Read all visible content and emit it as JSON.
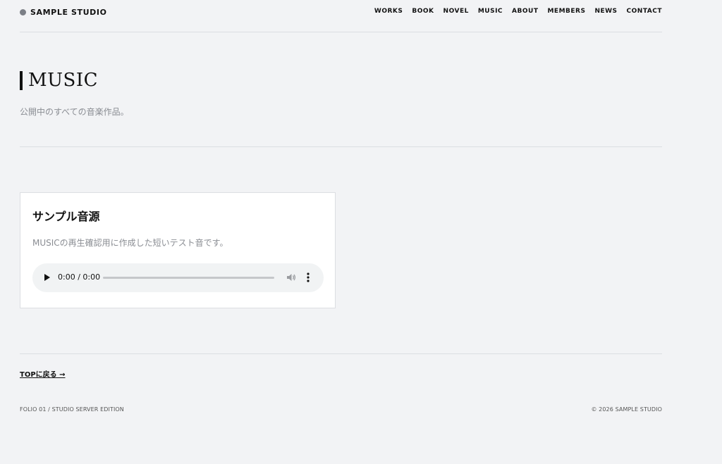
{
  "header": {
    "brand": "SAMPLE STUDIO",
    "nav": [
      "WORKS",
      "BOOK",
      "NOVEL",
      "MUSIC",
      "ABOUT",
      "MEMBERS",
      "NEWS",
      "CONTACT"
    ]
  },
  "page": {
    "title": "MUSIC",
    "description": "公開中のすべての音楽作品。"
  },
  "track": {
    "title": "サンプル音源",
    "description": "MUSICの再生確認用に作成した短いテスト音です。",
    "player": {
      "time": "0:00 / 0:00",
      "progress": 0,
      "icons": [
        "play-icon",
        "volume-icon",
        "more-options-icon"
      ]
    }
  },
  "back_link": "TOPに戻る →",
  "footer": {
    "left": "FOLIO 01 / STUDIO SERVER EDITION",
    "right": "© 2026 SAMPLE STUDIO"
  },
  "colors": {
    "background": "#f2f3f5",
    "card": "#ffffff",
    "text": "#111111",
    "muted": "#8a8d93",
    "player_bg": "#f1f3f4"
  }
}
